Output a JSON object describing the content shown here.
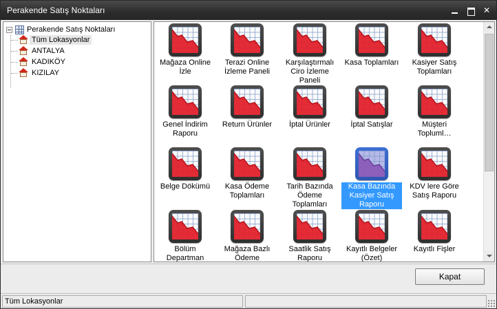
{
  "window": {
    "title": "Perakende Satış Noktaları"
  },
  "tree": {
    "root_label": "Perakende Satış Noktaları",
    "items": [
      {
        "label": "Tüm Lokasyonlar",
        "selected": true
      },
      {
        "label": "ANTALYA",
        "selected": false
      },
      {
        "label": "KADIKÖY",
        "selected": false
      },
      {
        "label": "KIZILAY",
        "selected": false
      }
    ]
  },
  "reports": [
    {
      "label": "Mağaza Online İzle"
    },
    {
      "label": "Terazi Online İzleme Paneli"
    },
    {
      "label": "Karşılaştırmalı Ciro İzleme Paneli"
    },
    {
      "label": "Kasa Toplamları"
    },
    {
      "label": "Kasiyer Satış Toplamları"
    },
    {
      "label": "Genel İndirim Raporu"
    },
    {
      "label": "Return Ürünler"
    },
    {
      "label": "İptal Ürünler"
    },
    {
      "label": "İptal Satışlar"
    },
    {
      "label": "Müşteri Topluml…"
    },
    {
      "label": "Belge Dökümü"
    },
    {
      "label": "Kasa Ödeme Toplamları"
    },
    {
      "label": "Tarih Bazında Ödeme Toplamları"
    },
    {
      "label": "Kasa Bazında Kasiyer Satış Raporu",
      "selected": true
    },
    {
      "label": "KDV lere Göre Satış Raporu"
    },
    {
      "label": "Bölüm Departman Satışları"
    },
    {
      "label": "Mağaza Bazlı Ödeme Toplamları"
    },
    {
      "label": "Saatlik Satış Raporu"
    },
    {
      "label": "Kayıtlı Belgeler (Özet)"
    },
    {
      "label": "Kayıtlı Fişler"
    }
  ],
  "buttons": {
    "close_label": "Kapat"
  },
  "status": {
    "left": "Tüm Lokasyonlar",
    "right": ""
  },
  "icons": {
    "report": "report-chart-icon",
    "tree_root": "grid-table-icon",
    "location": "store-house-icon"
  }
}
